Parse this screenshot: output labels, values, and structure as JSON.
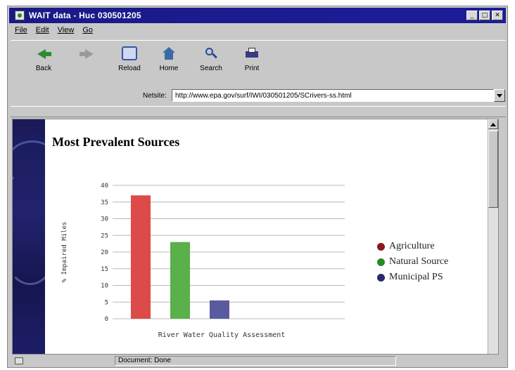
{
  "window": {
    "title": "WAIT data - Huc 030501205",
    "controls": [
      "_",
      "□",
      "✕"
    ]
  },
  "menu": [
    "File",
    "Edit",
    "View",
    "Go"
  ],
  "toolbar": {
    "buttons": [
      {
        "label": "Back",
        "icon": "back-arrow-icon"
      },
      {
        "label": "",
        "icon": "forward-arrow-icon"
      },
      {
        "label": "Reload",
        "icon": "reload-icon"
      },
      {
        "label": "Home",
        "icon": "home-icon"
      },
      {
        "label": "Search",
        "icon": "search-icon"
      },
      {
        "label": "Print",
        "icon": "print-icon"
      }
    ]
  },
  "address": {
    "label": "Netsite:",
    "value": "http://www.epa.gov/surf/IWI/030501205/SCrivers-ss.html"
  },
  "page": {
    "title": "Most Prevalent Sources"
  },
  "status": {
    "text": "Document: Done"
  },
  "colors": {
    "agriculture": "#dd4a4a",
    "natural_source": "#5ab04a",
    "municipal_ps": "#5a5aa0"
  },
  "chart_data": {
    "type": "bar",
    "categories": [
      "Agriculture",
      "Natural Source",
      "Municipal PS"
    ],
    "values": [
      37,
      23,
      5.5
    ],
    "xlabel": "River Water Quality Assessment",
    "ylabel": "% Impaired Miles",
    "ylim": [
      0,
      40
    ],
    "yticks": [
      0,
      5,
      10,
      15,
      20,
      25,
      30,
      35,
      40
    ],
    "grid": true,
    "legend": {
      "placement": "right",
      "entries": [
        "Agriculture",
        "Natural Source",
        "Municipal PS"
      ]
    }
  }
}
